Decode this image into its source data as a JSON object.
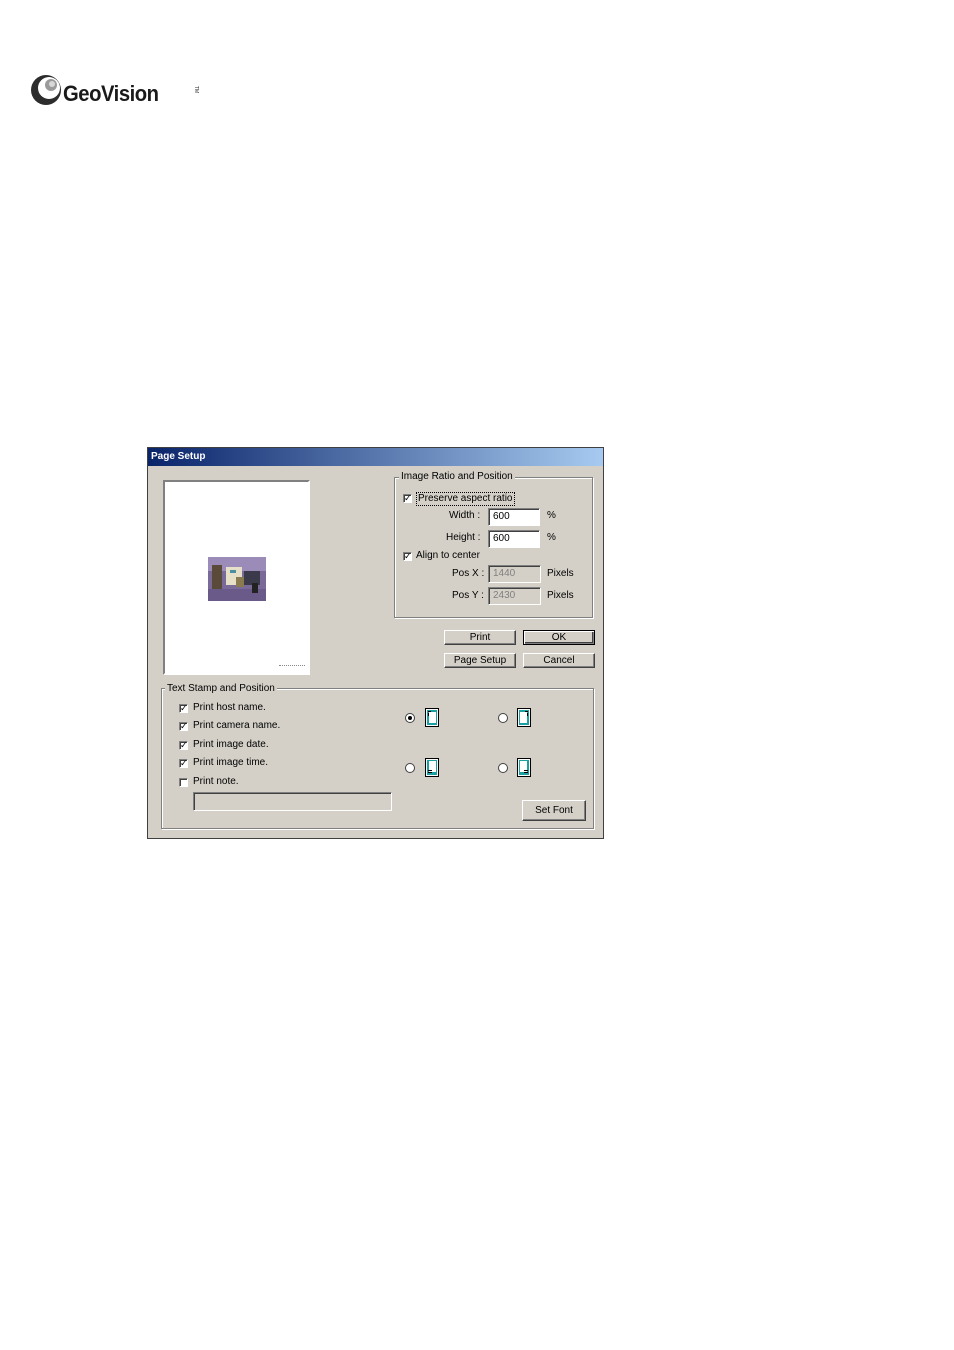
{
  "logo": {
    "wordmark": "GeoVision",
    "trademark": "TM"
  },
  "dialog": {
    "title": "Page Setup",
    "image_ratio": {
      "group_title": "Image Ratio and Position",
      "preserve_aspect_ratio": {
        "label": "Preserve aspect ratio",
        "checked": true
      },
      "width": {
        "label": "Width :",
        "value": "600",
        "unit": "%"
      },
      "height": {
        "label": "Height :",
        "value": "600",
        "unit": "%"
      },
      "align_center": {
        "label": "Align to center",
        "checked": true
      },
      "pos_x": {
        "label": "Pos X :",
        "value": "1440",
        "unit": "Pixels"
      },
      "pos_y": {
        "label": "Pos Y :",
        "value": "2430",
        "unit": "Pixels"
      }
    },
    "buttons": {
      "print": "Print",
      "ok": "OK",
      "page_setup": "Page Setup",
      "cancel": "Cancel",
      "set_font": "Set Font"
    },
    "text_stamp": {
      "group_title": "Text Stamp and Position",
      "options": [
        {
          "label": "Print host name.",
          "checked": true
        },
        {
          "label": "Print camera name.",
          "checked": true
        },
        {
          "label": "Print image date.",
          "checked": true
        },
        {
          "label": "Print image time.",
          "checked": true
        },
        {
          "label": "Print note.",
          "checked": false
        }
      ],
      "note_value": "",
      "positions": [
        {
          "name": "top-left",
          "selected": true
        },
        {
          "name": "top-right",
          "selected": false
        },
        {
          "name": "bottom-left",
          "selected": false
        },
        {
          "name": "bottom-right",
          "selected": false
        }
      ]
    }
  }
}
